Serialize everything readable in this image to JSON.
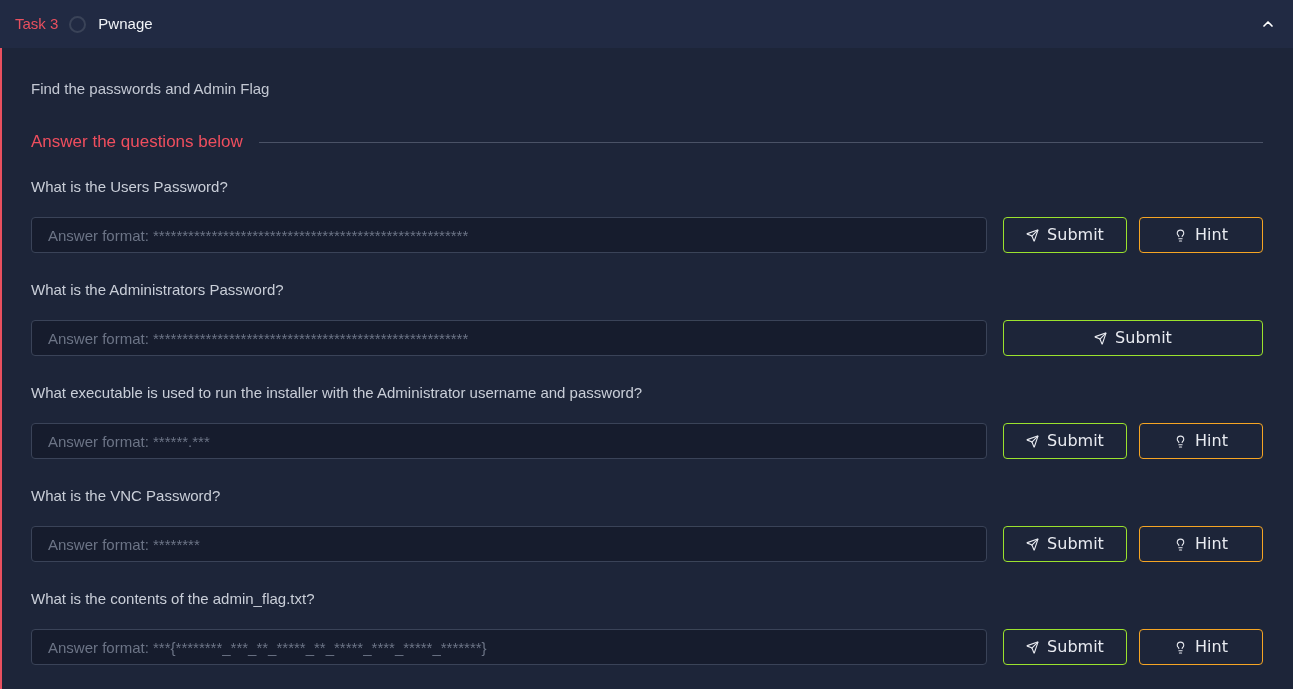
{
  "task": {
    "number": "Task 3",
    "title": "Pwnage",
    "completed": false,
    "expanded": true
  },
  "description": "Find the passwords and Admin Flag",
  "questions_heading": "Answer the questions below",
  "questions": [
    {
      "question": "What is the Users Password?",
      "placeholder": "Answer format: ******************************************************",
      "buttons": [
        {
          "kind": "submit",
          "label": "Submit"
        },
        {
          "kind": "hint",
          "label": "Hint"
        }
      ]
    },
    {
      "question": "What is the Administrators Password?",
      "placeholder": "Answer format: ******************************************************",
      "buttons": [
        {
          "kind": "submit",
          "label": "Submit"
        }
      ]
    },
    {
      "question": "What executable is used to run the installer with the Administrator username and password?",
      "placeholder": "Answer format: ******.***",
      "buttons": [
        {
          "kind": "submit",
          "label": "Submit"
        },
        {
          "kind": "hint",
          "label": "Hint"
        }
      ]
    },
    {
      "question": "What is the VNC Password?",
      "placeholder": "Answer format: ********",
      "buttons": [
        {
          "kind": "submit",
          "label": "Submit"
        },
        {
          "kind": "hint",
          "label": "Hint"
        }
      ]
    },
    {
      "question": "What is the contents of the admin_flag.txt?",
      "placeholder": "Answer format: ***{********_***_**_*****_**_*****_****_*****_*******}",
      "buttons": [
        {
          "kind": "submit",
          "label": "Submit"
        },
        {
          "kind": "hint",
          "label": "Hint"
        }
      ]
    }
  ]
}
